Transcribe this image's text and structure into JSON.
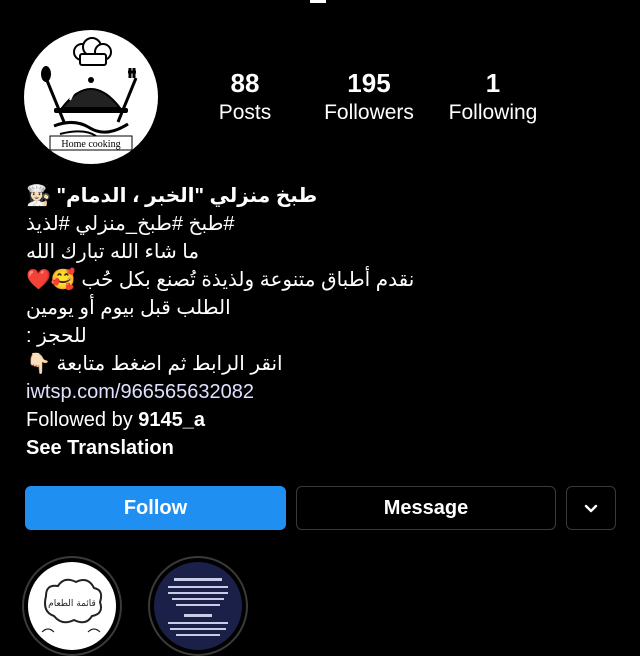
{
  "profile": {
    "avatar_text": "Home cooking",
    "stats": {
      "posts_count": "88",
      "posts_label": "Posts",
      "followers_count": "195",
      "followers_label": "Followers",
      "following_count": "1",
      "following_label": "Following"
    },
    "bio": {
      "name": "طبخ منزلي \"الخبر ، الدمام\"",
      "name_emoji": "👩🏻‍🍳",
      "hashtags": "#طبخ #طبخ_منزلي #لذيذ",
      "line_blessing": "ما شاء الله تبارك الله",
      "line_offer": "نقدم أطباق متنوعة ولذيذة تُصنع بكل حُب",
      "line_offer_emojis": "🥰❤️",
      "line_order": "الطلب قبل بيوم أو يومين",
      "line_booking": "للحجز :",
      "line_click": "انقر الرابط ثم اضغط متابعة",
      "line_click_emoji": "👇🏻",
      "link": "iwtsp.com/966565632082",
      "followed_by_prefix": "Followed by",
      "followed_by_user": "9145_a",
      "see_translation": "See Translation"
    }
  },
  "actions": {
    "follow_label": "Follow",
    "message_label": "Message",
    "more_icon": "chevron-down-icon"
  },
  "highlights": [
    {
      "text": "قائمة الطعام"
    },
    {
      "text": ""
    }
  ],
  "colors": {
    "accent": "#1f8ff2",
    "background": "#000000",
    "button_border": "#3a3a3a"
  }
}
